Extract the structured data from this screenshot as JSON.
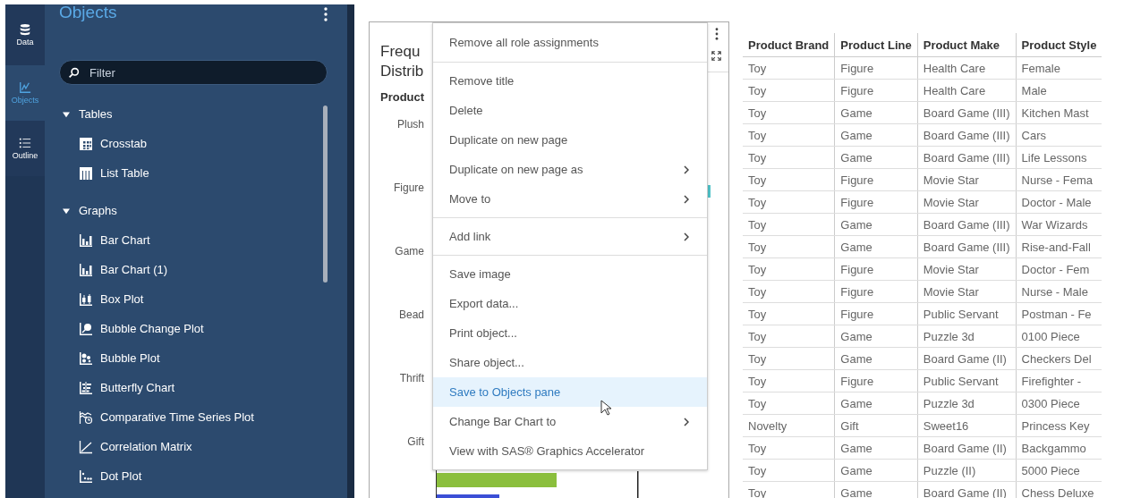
{
  "rail": [
    {
      "label": "Data",
      "kind": "data",
      "selected": false
    },
    {
      "label": "Objects",
      "kind": "objects",
      "selected": true
    },
    {
      "label": "Outline",
      "kind": "outline",
      "selected": false
    }
  ],
  "objects_pane": {
    "title": "Objects",
    "filter": {
      "placeholder": "Filter"
    },
    "tree": [
      {
        "label": "Tables",
        "expanded": true,
        "children": [
          {
            "label": "Crosstab",
            "kind": "crosstab"
          },
          {
            "label": "List Table",
            "kind": "list-table"
          }
        ]
      },
      {
        "label": "Graphs",
        "expanded": true,
        "children": [
          {
            "label": "Bar Chart",
            "kind": "bar"
          },
          {
            "label": "Bar Chart (1)",
            "kind": "bar"
          },
          {
            "label": "Box Plot",
            "kind": "box"
          },
          {
            "label": "Bubble Change Plot",
            "kind": "bubble-change"
          },
          {
            "label": "Bubble Plot",
            "kind": "bubble"
          },
          {
            "label": "Butterfly Chart",
            "kind": "butterfly"
          },
          {
            "label": "Comparative Time Series Plot",
            "kind": "time-series"
          },
          {
            "label": "Correlation Matrix",
            "kind": "correlation"
          },
          {
            "label": "Dot Plot",
            "kind": "dot"
          }
        ]
      }
    ]
  },
  "chart": {
    "title_lines": [
      "Frequ",
      "Distrib"
    ],
    "axis_label": "Product",
    "categories": [
      "Plush",
      "Figure",
      "Game",
      "Bead",
      "Thrift",
      "Gift"
    ]
  },
  "context_menu": {
    "groups": [
      [
        {
          "label": "Remove all role assignments",
          "submenu": false,
          "selected": false
        }
      ],
      [
        {
          "label": "Remove title",
          "submenu": false,
          "selected": false
        },
        {
          "label": "Delete",
          "submenu": false,
          "selected": false
        },
        {
          "label": "Duplicate on new page",
          "submenu": false,
          "selected": false
        },
        {
          "label": "Duplicate on new page as",
          "submenu": true,
          "selected": false
        },
        {
          "label": "Move to",
          "submenu": true,
          "selected": false
        }
      ],
      [
        {
          "label": "Add link",
          "submenu": true,
          "selected": false
        }
      ],
      [
        {
          "label": "Save image",
          "submenu": false,
          "selected": false
        },
        {
          "label": "Export data...",
          "submenu": false,
          "selected": false
        },
        {
          "label": "Print object...",
          "submenu": false,
          "selected": false
        },
        {
          "label": "Share object...",
          "submenu": false,
          "selected": false
        },
        {
          "label": "Save to Objects pane",
          "submenu": false,
          "selected": true
        },
        {
          "label": "Change Bar Chart to",
          "submenu": true,
          "selected": false
        },
        {
          "label": "View with SAS® Graphics Accelerator",
          "submenu": false,
          "selected": false
        }
      ]
    ]
  },
  "table": {
    "columns": [
      "Product Brand",
      "Product Line",
      "Product Make",
      "Product Style"
    ],
    "rows": [
      [
        "Toy",
        "Figure",
        "Health Care",
        "Female"
      ],
      [
        "Toy",
        "Figure",
        "Health Care",
        "Male"
      ],
      [
        "Toy",
        "Game",
        "Board Game (III)",
        "Kitchen Mast"
      ],
      [
        "Toy",
        "Game",
        "Board Game (III)",
        "Cars"
      ],
      [
        "Toy",
        "Game",
        "Board Game (III)",
        "Life Lessons"
      ],
      [
        "Toy",
        "Figure",
        "Movie Star",
        "Nurse - Fema"
      ],
      [
        "Toy",
        "Figure",
        "Movie Star",
        "Doctor - Male"
      ],
      [
        "Toy",
        "Game",
        "Board Game (III)",
        "War Wizards"
      ],
      [
        "Toy",
        "Game",
        "Board Game (III)",
        "Rise-and-Fall"
      ],
      [
        "Toy",
        "Figure",
        "Movie Star",
        "Doctor - Fem"
      ],
      [
        "Toy",
        "Figure",
        "Movie Star",
        "Nurse - Male"
      ],
      [
        "Toy",
        "Figure",
        "Public Servant",
        "Postman - Fe"
      ],
      [
        "Toy",
        "Game",
        "Puzzle 3d",
        "0100 Piece"
      ],
      [
        "Toy",
        "Game",
        "Board Game (II)",
        "Checkers Del"
      ],
      [
        "Toy",
        "Figure",
        "Public Servant",
        "Firefighter -"
      ],
      [
        "Toy",
        "Game",
        "Puzzle 3d",
        "0300 Piece"
      ],
      [
        "Novelty",
        "Gift",
        "Sweet16",
        "Princess Key"
      ],
      [
        "Toy",
        "Game",
        "Board Game (II)",
        "Backgammo"
      ],
      [
        "Toy",
        "Game",
        "Puzzle (II)",
        "5000 Piece"
      ],
      [
        "Toy",
        "Game",
        "Board Game (II)",
        "Chess Deluxe"
      ]
    ]
  }
}
